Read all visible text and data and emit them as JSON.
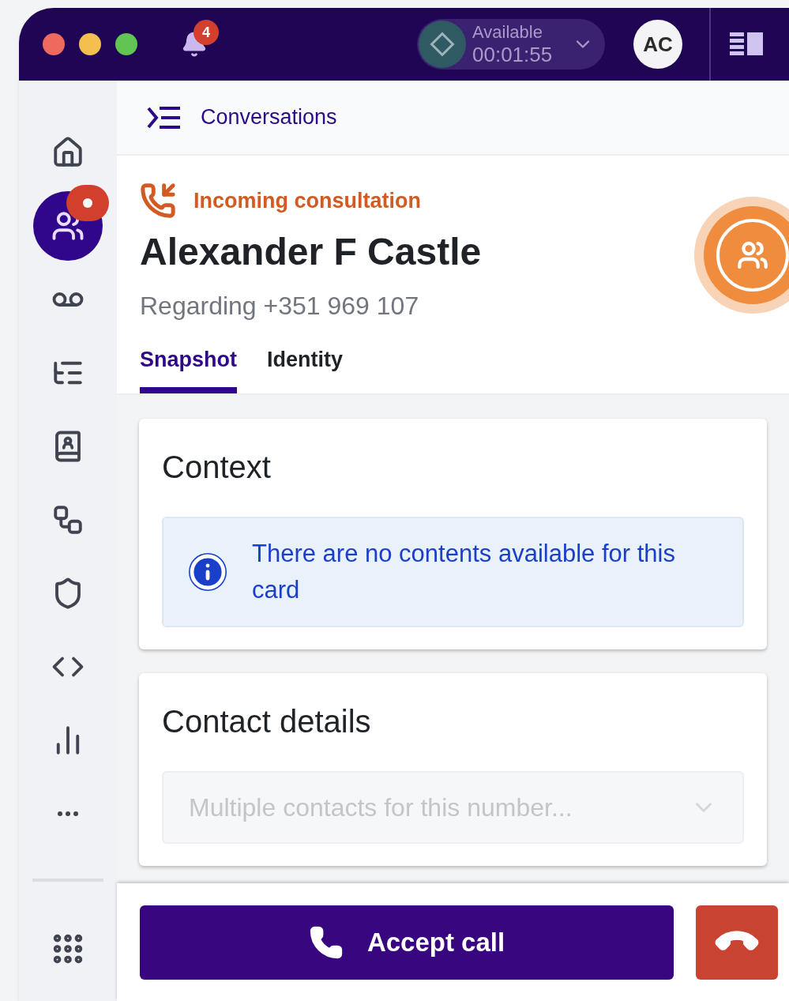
{
  "top_bar": {
    "notifications": {
      "count": "4"
    },
    "status": {
      "label": "Available",
      "timer": "00:01:55"
    },
    "avatar": "AC"
  },
  "sidebar": {
    "items": [
      {
        "selected": false,
        "alert": false
      },
      {
        "selected": true,
        "alert": true
      },
      {
        "selected": false,
        "alert": false
      },
      {
        "selected": false,
        "alert": false
      },
      {
        "selected": false,
        "alert": false
      },
      {
        "selected": false,
        "alert": false
      },
      {
        "selected": false,
        "alert": false
      },
      {
        "selected": false,
        "alert": false
      },
      {
        "selected": false,
        "alert": false
      },
      {
        "selected": false,
        "alert": false
      }
    ]
  },
  "header": {
    "title": "Conversations"
  },
  "call": {
    "status": "Incoming consultation",
    "name": "Alexander F Castle",
    "regarding": "Regarding +351 969 107"
  },
  "tabs": [
    {
      "label": "Snapshot",
      "selected": true
    },
    {
      "label": "Identity",
      "selected": false
    }
  ],
  "cards": [
    {
      "kind": "info",
      "title": "Context",
      "message": "There are no contents available for this card"
    },
    {
      "kind": "select",
      "title": "Contact details",
      "placeholder": "Multiple contacts for this number..."
    }
  ],
  "actions": {
    "accept": "Accept call"
  }
}
